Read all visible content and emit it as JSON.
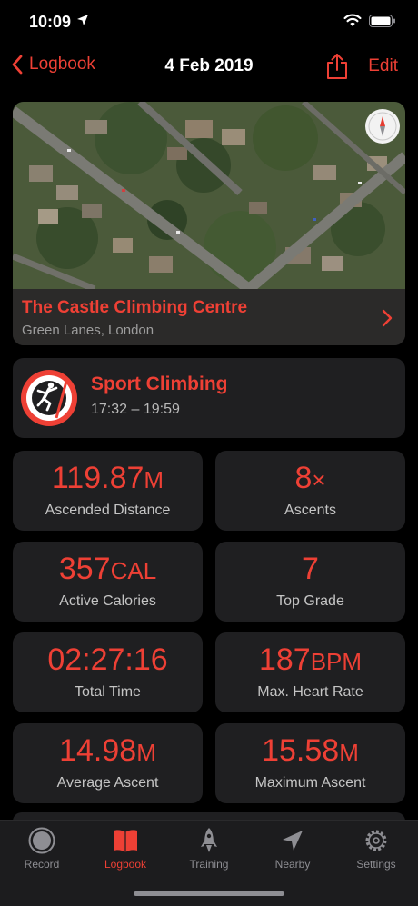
{
  "status_bar": {
    "time": "10:09"
  },
  "nav": {
    "back_label": "Logbook",
    "title": "4 Feb 2019",
    "edit_label": "Edit"
  },
  "location": {
    "name": "The Castle Climbing Centre",
    "address": "Green Lanes, London"
  },
  "activity": {
    "name": "Sport Climbing",
    "time_range": "17:32 – 19:59"
  },
  "stats": [
    {
      "value": "119.87",
      "unit": "M",
      "label": "Ascended Distance"
    },
    {
      "value": "8",
      "unit": "×",
      "label": "Ascents"
    },
    {
      "value": "357",
      "unit": "CAL",
      "label": "Active Calories"
    },
    {
      "value": "7",
      "unit": "",
      "label": "Top Grade"
    },
    {
      "value": "02:27:16",
      "unit": "",
      "label": "Total Time"
    },
    {
      "value": "187",
      "unit": "BPM",
      "label": "Max. Heart Rate"
    },
    {
      "value": "14.98",
      "unit": "M",
      "label": "Average Ascent"
    },
    {
      "value": "15.58",
      "unit": "M",
      "label": "Maximum Ascent"
    }
  ],
  "tabs": [
    {
      "label": "Record",
      "icon": "record-icon",
      "active": false
    },
    {
      "label": "Logbook",
      "icon": "book-icon",
      "active": true
    },
    {
      "label": "Training",
      "icon": "rocket-icon",
      "active": false
    },
    {
      "label": "Nearby",
      "icon": "location-arrow-icon",
      "active": false
    },
    {
      "label": "Settings",
      "icon": "gear-icon",
      "active": false
    }
  ],
  "colors": {
    "accent": "#ee4035",
    "background": "#000000",
    "card": "#1f1f21",
    "tab_bar": "#1c1c1e"
  }
}
